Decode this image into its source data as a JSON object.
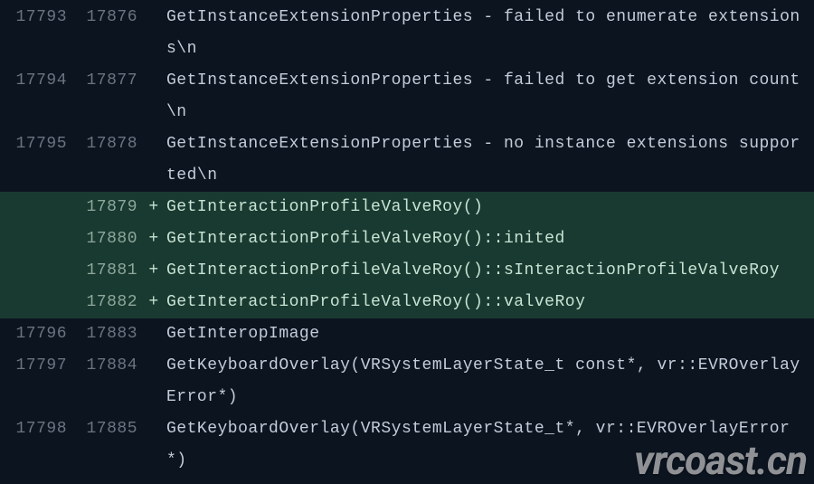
{
  "watermark": "vrcoast.cn",
  "rows": [
    {
      "old": "17793",
      "new": "17876",
      "mark": " ",
      "kind": "ctx",
      "text": "GetInstanceExtensionProperties - failed to enumerate extensions\\n"
    },
    {
      "old": "17794",
      "new": "17877",
      "mark": " ",
      "kind": "ctx",
      "text": "GetInstanceExtensionProperties - failed to get extension count\\n"
    },
    {
      "old": "17795",
      "new": "17878",
      "mark": " ",
      "kind": "ctx",
      "text": "GetInstanceExtensionProperties - no instance extensions supported\\n"
    },
    {
      "old": "",
      "new": "17879",
      "mark": "+",
      "kind": "add",
      "text": "GetInteractionProfileValveRoy()"
    },
    {
      "old": "",
      "new": "17880",
      "mark": "+",
      "kind": "add",
      "text": "GetInteractionProfileValveRoy()::inited"
    },
    {
      "old": "",
      "new": "17881",
      "mark": "+",
      "kind": "add",
      "text": "GetInteractionProfileValveRoy()::sInteractionProfileValveRoy"
    },
    {
      "old": "",
      "new": "17882",
      "mark": "+",
      "kind": "add",
      "text": "GetInteractionProfileValveRoy()::valveRoy"
    },
    {
      "old": "17796",
      "new": "17883",
      "mark": " ",
      "kind": "ctx",
      "text": "GetInteropImage"
    },
    {
      "old": "17797",
      "new": "17884",
      "mark": " ",
      "kind": "ctx",
      "text": "GetKeyboardOverlay(VRSystemLayerState_t const*, vr::EVROverlayError*)"
    },
    {
      "old": "17798",
      "new": "17885",
      "mark": " ",
      "kind": "ctx",
      "text": "GetKeyboardOverlay(VRSystemLayerState_t*, vr::EVROverlayError*)"
    }
  ]
}
